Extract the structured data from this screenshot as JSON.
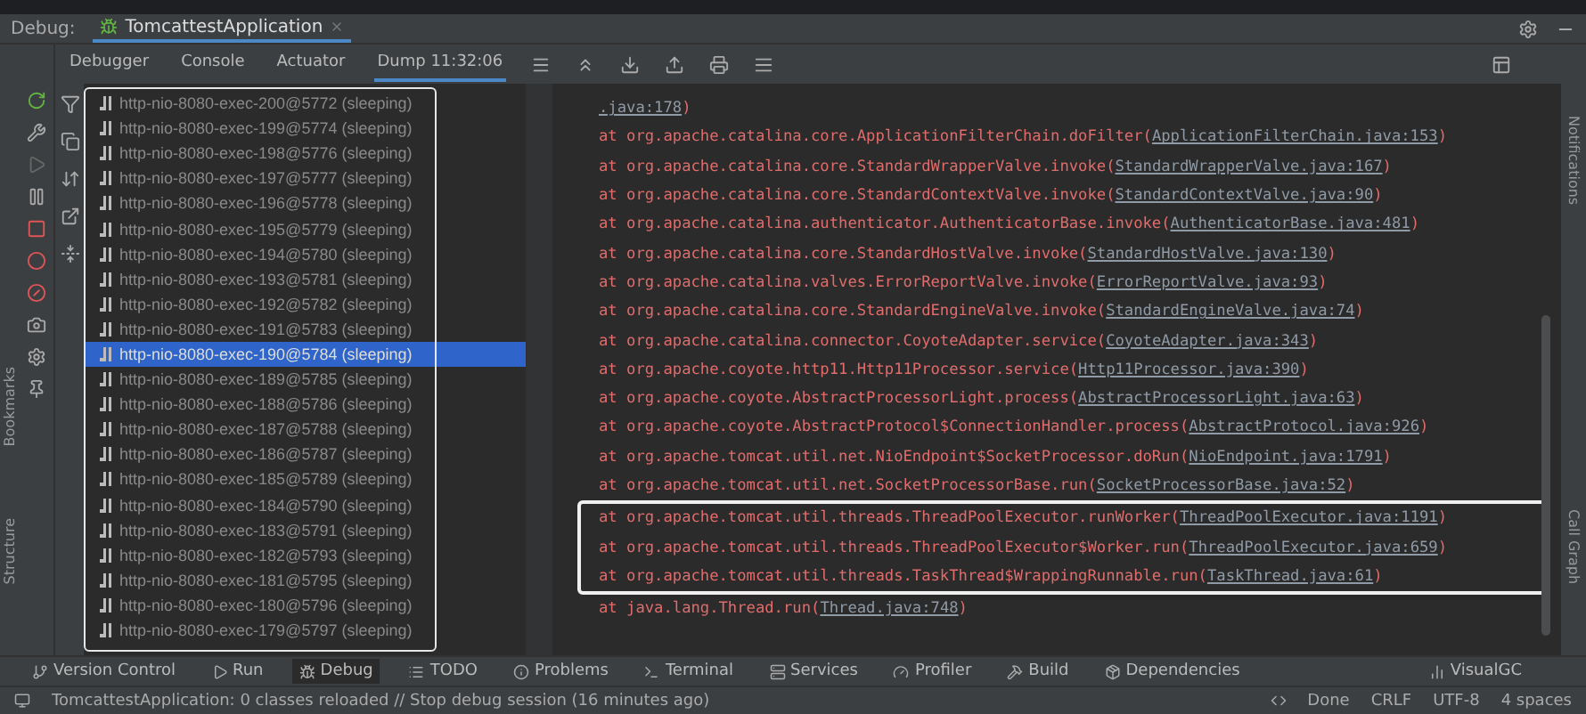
{
  "debug_bar": {
    "label": "Debug:",
    "tab": "TomcattestApplication"
  },
  "subtabs": [
    {
      "label": "Debugger",
      "selected": false
    },
    {
      "label": "Console",
      "selected": false
    },
    {
      "label": "Actuator",
      "selected": false
    },
    {
      "label": "Dump 11:32:06",
      "selected": true
    }
  ],
  "threads": [
    {
      "name": "http-nio-8080-exec-200@5772 (sleeping)",
      "selected": false
    },
    {
      "name": "http-nio-8080-exec-199@5774 (sleeping)",
      "selected": false
    },
    {
      "name": "http-nio-8080-exec-198@5776 (sleeping)",
      "selected": false
    },
    {
      "name": "http-nio-8080-exec-197@5777 (sleeping)",
      "selected": false
    },
    {
      "name": "http-nio-8080-exec-196@5778 (sleeping)",
      "selected": false
    },
    {
      "name": "http-nio-8080-exec-195@5779 (sleeping)",
      "selected": false
    },
    {
      "name": "http-nio-8080-exec-194@5780 (sleeping)",
      "selected": false
    },
    {
      "name": "http-nio-8080-exec-193@5781 (sleeping)",
      "selected": false
    },
    {
      "name": "http-nio-8080-exec-192@5782 (sleeping)",
      "selected": false
    },
    {
      "name": "http-nio-8080-exec-191@5783 (sleeping)",
      "selected": false
    },
    {
      "name": "http-nio-8080-exec-190@5784 (sleeping)",
      "selected": true
    },
    {
      "name": "http-nio-8080-exec-189@5785 (sleeping)",
      "selected": false
    },
    {
      "name": "http-nio-8080-exec-188@5786 (sleeping)",
      "selected": false
    },
    {
      "name": "http-nio-8080-exec-187@5788 (sleeping)",
      "selected": false
    },
    {
      "name": "http-nio-8080-exec-186@5787 (sleeping)",
      "selected": false
    },
    {
      "name": "http-nio-8080-exec-185@5789 (sleeping)",
      "selected": false
    },
    {
      "name": "http-nio-8080-exec-184@5790 (sleeping)",
      "selected": false
    },
    {
      "name": "http-nio-8080-exec-183@5791 (sleeping)",
      "selected": false
    },
    {
      "name": "http-nio-8080-exec-182@5793 (sleeping)",
      "selected": false
    },
    {
      "name": "http-nio-8080-exec-181@5795 (sleeping)",
      "selected": false
    },
    {
      "name": "http-nio-8080-exec-180@5796 (sleeping)",
      "selected": false
    },
    {
      "name": "http-nio-8080-exec-179@5797 (sleeping)",
      "selected": false
    }
  ],
  "stack": [
    {
      "kind": "continuation",
      "link": ".java:178",
      "tail": ")",
      "highlighted": false
    },
    {
      "kind": "frame",
      "text": "at org.apache.catalina.core.ApplicationFilterChain.doFilter(",
      "tail": ")",
      "link": "ApplicationFilterChain.java:153",
      "highlighted": false
    },
    {
      "kind": "frame",
      "text": "at org.apache.catalina.core.StandardWrapperValve.invoke(",
      "tail": ")",
      "link": "StandardWrapperValve.java:167",
      "highlighted": false
    },
    {
      "kind": "frame",
      "text": "at org.apache.catalina.core.StandardContextValve.invoke(",
      "tail": ")",
      "link": "StandardContextValve.java:90",
      "highlighted": false
    },
    {
      "kind": "frame",
      "text": "at org.apache.catalina.authenticator.AuthenticatorBase.invoke(",
      "tail": ")",
      "link": "AuthenticatorBase.java:481",
      "highlighted": false
    },
    {
      "kind": "frame",
      "text": "at org.apache.catalina.core.StandardHostValve.invoke(",
      "tail": ")",
      "link": "StandardHostValve.java:130",
      "highlighted": false
    },
    {
      "kind": "frame",
      "text": "at org.apache.catalina.valves.ErrorReportValve.invoke(",
      "tail": ")",
      "link": "ErrorReportValve.java:93",
      "highlighted": false
    },
    {
      "kind": "frame",
      "text": "at org.apache.catalina.core.StandardEngineValve.invoke(",
      "tail": ")",
      "link": "StandardEngineValve.java:74",
      "highlighted": false
    },
    {
      "kind": "frame",
      "text": "at org.apache.catalina.connector.CoyoteAdapter.service(",
      "tail": ")",
      "link": "CoyoteAdapter.java:343",
      "highlighted": false
    },
    {
      "kind": "frame",
      "text": "at org.apache.coyote.http11.Http11Processor.service(",
      "tail": ")",
      "link": "Http11Processor.java:390",
      "highlighted": false
    },
    {
      "kind": "frame",
      "text": "at org.apache.coyote.AbstractProcessorLight.process(",
      "tail": ")",
      "link": "AbstractProcessorLight.java:63",
      "highlighted": false
    },
    {
      "kind": "frame",
      "text": "at org.apache.coyote.AbstractProtocol$ConnectionHandler.process(",
      "tail": ")",
      "link": "AbstractProtocol.java:926",
      "highlighted": false
    },
    {
      "kind": "frame",
      "text": "at org.apache.tomcat.util.net.NioEndpoint$SocketProcessor.doRun(",
      "tail": ")",
      "link": "NioEndpoint.java:1791",
      "highlighted": false
    },
    {
      "kind": "frame",
      "text": "at org.apache.tomcat.util.net.SocketProcessorBase.run(",
      "tail": ")",
      "link": "SocketProcessorBase.java:52",
      "highlighted": false
    },
    {
      "kind": "frame",
      "text": "at org.apache.tomcat.util.threads.ThreadPoolExecutor.runWorker(",
      "tail": ")",
      "link": "ThreadPoolExecutor.java:1191",
      "highlighted": true
    },
    {
      "kind": "frame",
      "text": "at org.apache.tomcat.util.threads.ThreadPoolExecutor$Worker.run(",
      "tail": ")",
      "link": "ThreadPoolExecutor.java:659",
      "highlighted": true
    },
    {
      "kind": "frame",
      "text": "at org.apache.tomcat.util.threads.TaskThread$WrappingRunnable.run(",
      "tail": ")",
      "link": "TaskThread.java:61",
      "highlighted": true
    },
    {
      "kind": "frame",
      "text": "at java.lang.Thread.run(",
      "tail": ")",
      "link": "Thread.java:748",
      "highlighted": false
    }
  ],
  "left_strip": [
    "Bookmarks",
    "Structure"
  ],
  "right_strip": [
    "Notifications",
    "Call Graph"
  ],
  "tool_windows": [
    {
      "label": "Version Control",
      "selected": false
    },
    {
      "label": "Run",
      "selected": false
    },
    {
      "label": "Debug",
      "selected": true
    },
    {
      "label": "TODO",
      "selected": false
    },
    {
      "label": "Problems",
      "selected": false
    },
    {
      "label": "Terminal",
      "selected": false
    },
    {
      "label": "Services",
      "selected": false
    },
    {
      "label": "Profiler",
      "selected": false
    },
    {
      "label": "Build",
      "selected": false
    },
    {
      "label": "Dependencies",
      "selected": false
    }
  ],
  "visualgc": "VisualGC",
  "status": {
    "message": "TomcattestApplication: 0 classes reloaded // Stop debug session (16 minutes ago)",
    "items": [
      "Done",
      "CRLF",
      "UTF-8",
      "4 spaces"
    ]
  }
}
